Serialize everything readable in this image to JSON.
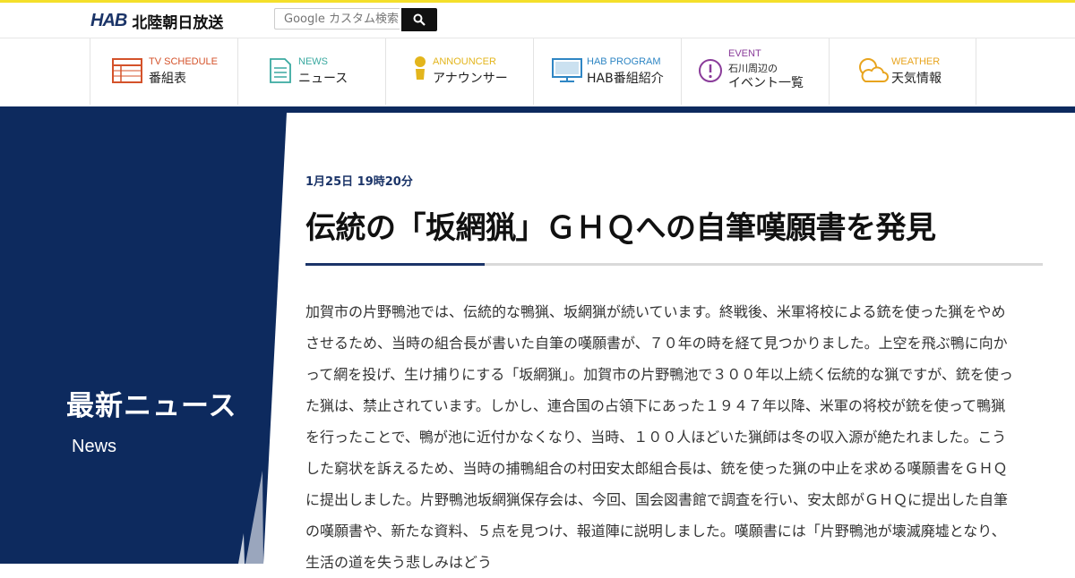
{
  "header": {
    "logo_mark": "HAB",
    "logo_text": "北陸朝日放送",
    "search_placeholder": "Google カスタム検索",
    "search_icon": "search-icon"
  },
  "nav": [
    {
      "en": "TV SCHEDULE",
      "ja": "番組表",
      "icon": "tv-schedule-icon",
      "color": "#d4522a"
    },
    {
      "en": "NEWS",
      "ja": "ニュース",
      "icon": "news-icon",
      "color": "#3aa9a0"
    },
    {
      "en": "ANNOUNCER",
      "ja": "アナウンサー",
      "icon": "announcer-icon",
      "color": "#e3b51c"
    },
    {
      "en": "HAB PROGRAM",
      "ja": "HAB番組紹介",
      "icon": "monitor-icon",
      "color": "#2f86c4"
    },
    {
      "en": "EVENT",
      "ja_small": "石川周辺の",
      "ja": "イベント一覧",
      "icon": "event-icon",
      "color": "#8a3c9a"
    },
    {
      "en": "WEATHER",
      "ja": "天気情報",
      "icon": "weather-icon",
      "color": "#e8a41e"
    }
  ],
  "section": {
    "title": "最新ニュース",
    "subtitle": "News"
  },
  "article": {
    "date": "1月25日 19時20分",
    "title": "伝統の「坂網猟」ＧＨＱへの自筆嘆願書を発見",
    "body": "加賀市の片野鴨池では、伝統的な鴨猟、坂網猟が続いています。終戦後、米軍将校による銃を使った猟をやめさせるため、当時の組合長が書いた自筆の嘆願書が、７０年の時を経て見つかりました。上空を飛ぶ鴨に向かって網を投げ、生け捕りにする「坂網猟」。加賀市の片野鴨池で３００年以上続く伝統的な猟ですが、銃を使った猟は、禁止されています。しかし、連合国の占領下にあった１９４７年以降、米軍の将校が銃を使って鴨猟を行ったことで、鴨が池に近付かなくなり、当時、１００人ほどいた猟師は冬の収入源が絶たれました。こうした窮状を訴えるため、当時の捕鴨組合の村田安太郎組合長は、銃を使った猟の中止を求める嘆願書をＧＨＱに提出しました。片野鴨池坂網猟保存会は、今回、国会図書館で調査を行い、安太郎がＧＨＱに提出した自筆の嘆願書や、新たな資料、５点を見つけ、報道陣に説明しました。嘆願書には「片野鴨池が壊滅廃墟となり、生活の道を失う悲しみはどう"
  },
  "colors": {
    "navy": "#0d2a5e",
    "accent_yellow": "#f4df2a"
  }
}
